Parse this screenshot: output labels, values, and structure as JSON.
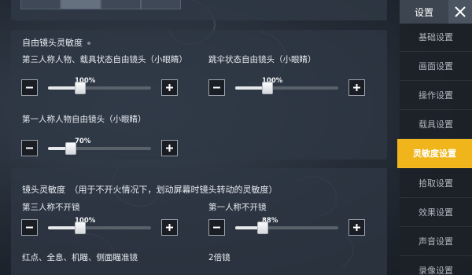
{
  "sidebar": {
    "title": "设置",
    "active_color": "#f0b51b",
    "items": [
      {
        "label": "基础设置",
        "active": false
      },
      {
        "label": "画面设置",
        "active": false
      },
      {
        "label": "操作设置",
        "active": false
      },
      {
        "label": "载具设置",
        "active": false
      },
      {
        "label": "灵敏度设置",
        "active": true
      },
      {
        "label": "拾取设置",
        "active": false
      },
      {
        "label": "效果设置",
        "active": false
      },
      {
        "label": "声音设置",
        "active": false
      },
      {
        "label": "录像设置",
        "active": false
      }
    ]
  },
  "free_look": {
    "title": "自由镜头灵敏度",
    "sliders": [
      {
        "label": "第三人称人物、载具状态自由镜头（小眼睛）",
        "value_text": "100%",
        "level": 0.31
      },
      {
        "label": "跳伞状态自由镜头（小眼睛）",
        "value_text": "100%",
        "level": 0.31
      },
      {
        "label": "第一人称人物自由镜头（小眼睛）",
        "value_text": "70%",
        "level": 0.22
      }
    ]
  },
  "lens": {
    "title": "镜头灵敏度　（用于不开火情况下，划动屏幕时镜头转动的灵敏度）",
    "sliders": [
      {
        "label": "第三人称不开镜",
        "value_text": "100%",
        "level": 0.31
      },
      {
        "label": "第一人称不开镜",
        "value_text": "88%",
        "level": 0.27
      }
    ],
    "next_labels": [
      "红点、全息、机瞄、侧面瞄准镜",
      "2倍镜"
    ]
  }
}
